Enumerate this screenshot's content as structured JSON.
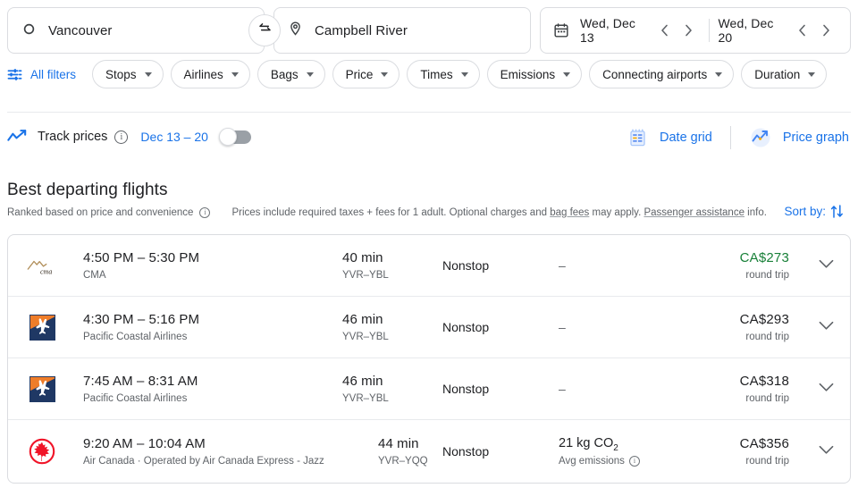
{
  "search": {
    "origin": {
      "value": "Vancouver",
      "icon": "circle-origin-icon"
    },
    "destination": {
      "value": "Campbell River",
      "icon": "location-pin-icon"
    },
    "swap_icon": "swap-horizontal-icon",
    "depart_date": "Wed, Dec 13",
    "return_date": "Wed, Dec 20",
    "calendar_icon": "calendar-icon"
  },
  "filters": {
    "all_filters_label": "All filters",
    "all_filters_icon": "tune-sliders-icon",
    "chips": [
      "Stops",
      "Airlines",
      "Bags",
      "Price",
      "Times",
      "Emissions",
      "Connecting airports",
      "Duration"
    ]
  },
  "track": {
    "icon": "trending-line-icon",
    "label": "Track prices",
    "info_icon": "info-icon",
    "dates": "Dec 13 – 20",
    "toggle_state": "off"
  },
  "views": {
    "date_grid": {
      "label": "Date grid",
      "icon": "date-grid-icon"
    },
    "price_graph": {
      "label": "Price graph",
      "icon": "price-graph-icon"
    }
  },
  "section": {
    "title": "Best departing flights",
    "ranked_note": "Ranked based on price and convenience",
    "ranked_info_icon": "info-icon",
    "prices_note_pre": "Prices include required taxes + fees for 1 adult. Optional charges and ",
    "bag_fees_link": "bag fees",
    "prices_note_mid": " may apply. ",
    "assistance_link": "Passenger assistance",
    "prices_note_post": " info.",
    "sort_by_label": "Sort by:",
    "sort_icon": "sort-arrows-icon"
  },
  "flights": [
    {
      "logo": "cma-logo",
      "times": "4:50 PM – 5:30 PM",
      "airline": "CMA",
      "duration": "40 min",
      "route": "YVR–YBL",
      "stops": "Nonstop",
      "emissions": "–",
      "emissions_sub": "",
      "price": "CA$273",
      "price_sub": "round trip",
      "price_color": "green",
      "expand_icon": "chevron-down-icon"
    },
    {
      "logo": "pacific-coastal-logo",
      "times": "4:30 PM – 5:16 PM",
      "airline": "Pacific Coastal Airlines",
      "duration": "46 min",
      "route": "YVR–YBL",
      "stops": "Nonstop",
      "emissions": "–",
      "emissions_sub": "",
      "price": "CA$293",
      "price_sub": "round trip",
      "price_color": "default",
      "expand_icon": "chevron-down-icon"
    },
    {
      "logo": "pacific-coastal-logo",
      "times": "7:45 AM – 8:31 AM",
      "airline": "Pacific Coastal Airlines",
      "duration": "46 min",
      "route": "YVR–YBL",
      "stops": "Nonstop",
      "emissions": "–",
      "emissions_sub": "",
      "price": "CA$318",
      "price_sub": "round trip",
      "price_color": "default",
      "expand_icon": "chevron-down-icon"
    },
    {
      "logo": "air-canada-logo",
      "times": "9:20 AM – 10:04 AM",
      "airline": "Air Canada · Operated by Air Canada Express - Jazz",
      "duration": "44 min",
      "route": "YVR–YQQ",
      "stops": "Nonstop",
      "emissions": "21 kg CO2",
      "emissions_sub": "Avg emissions",
      "price": "CA$356",
      "price_sub": "round trip",
      "price_color": "default",
      "expand_icon": "chevron-down-icon"
    }
  ],
  "colors": {
    "accent_blue": "#1a73e8",
    "price_green": "#188038",
    "text_primary": "#202124",
    "text_secondary": "#5f6368"
  }
}
